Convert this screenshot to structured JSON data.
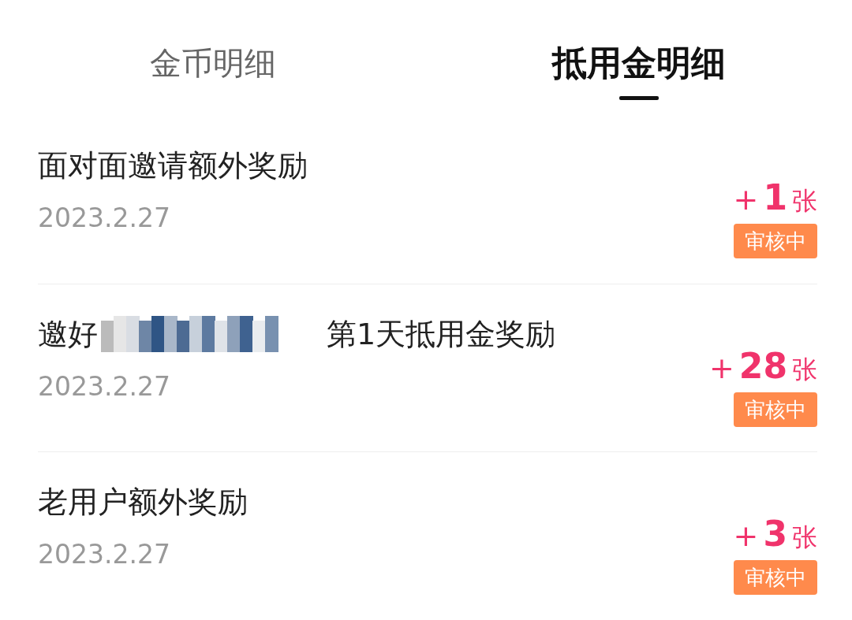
{
  "tabs": [
    {
      "label": "金币明细",
      "selected": false
    },
    {
      "label": "抵用金明细",
      "selected": true
    }
  ],
  "records": [
    {
      "title_parts": [
        {
          "kind": "text",
          "text": "面对面邀请额外奖励"
        }
      ],
      "date": "2023.2.27",
      "sign": "+",
      "amount": "1",
      "unit": "张",
      "status": "审核中"
    },
    {
      "title_parts": [
        {
          "kind": "text",
          "text": "邀好"
        },
        {
          "kind": "redacted"
        },
        {
          "kind": "text",
          "text": "第1天抵用金奖励"
        }
      ],
      "date": "2023.2.27",
      "sign": "+",
      "amount": "28",
      "unit": "张",
      "status": "审核中"
    },
    {
      "title_parts": [
        {
          "kind": "text",
          "text": "老用户额外奖励"
        }
      ],
      "date": "2023.2.27",
      "sign": "+",
      "amount": "3",
      "unit": "张",
      "status": "审核中"
    }
  ]
}
